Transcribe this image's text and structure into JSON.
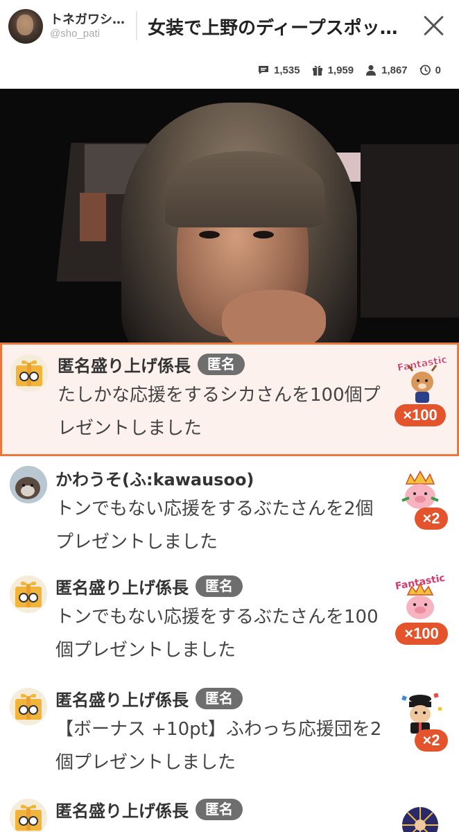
{
  "header": {
    "host_name": "トネガワシ…",
    "host_id": "@sho_pati",
    "title": "女装で上野のディープスポッ…"
  },
  "stats": {
    "comments": "1,535",
    "gifts": "1,959",
    "viewers": "1,867",
    "time": "0"
  },
  "feed": [
    {
      "name": "匿名盛り上げ係長",
      "badge": "匿名",
      "text": "たしかな応援をするシカさんを100個プレゼントしました",
      "count": "×100",
      "gift_icon": "deer-gift-icon"
    },
    {
      "name": "かわうそ(ふ:kawausoo)",
      "badge": "",
      "text": "トンでもない応援をするぶたさんを2個プレゼントしました",
      "count": "×2",
      "gift_icon": "pig-gift-icon"
    },
    {
      "name": "匿名盛り上げ係長",
      "badge": "匿名",
      "text": "トンでもない応援をするぶたさんを100個プレゼントしました",
      "count": "×100",
      "gift_icon": "pig-fantastic-gift-icon"
    },
    {
      "name": "匿名盛り上げ係長",
      "badge": "匿名",
      "text": "【ボーナス +10pt】ふわっち応援団を2個プレゼントしました",
      "count": "×2",
      "gift_icon": "cheer-squad-gift-icon"
    },
    {
      "name": "匿名盛り上げ係長",
      "badge": "匿名",
      "text": "",
      "count": "",
      "gift_icon": "fireworks-gift-icon"
    }
  ],
  "gift_labels": {
    "fantastic": "Fantastic"
  },
  "colors": {
    "accent": "#e8773e",
    "count_badge": "#e4542c",
    "anon_badge": "#6e6e6e"
  }
}
